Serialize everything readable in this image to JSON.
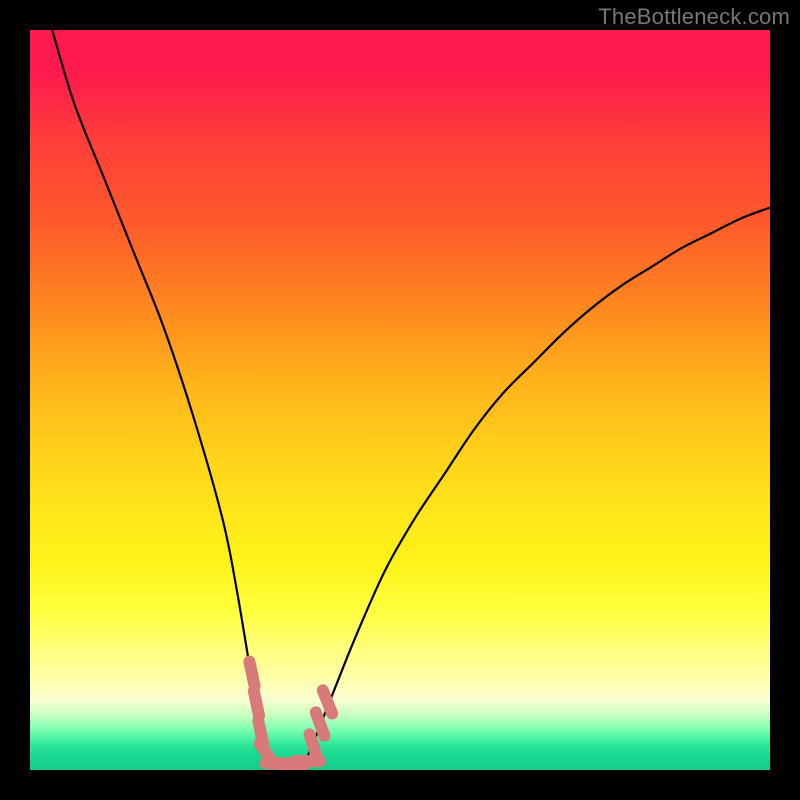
{
  "watermark": "TheBottleneck.com",
  "colors": {
    "page_bg": "#000000",
    "curve_stroke": "#000000",
    "marker": "#d97a7a",
    "marker_outline": "#d97a7a",
    "watermark_text": "#777777"
  },
  "chart_data": {
    "type": "line",
    "title": "",
    "xlabel": "",
    "ylabel": "",
    "xlim": [
      0,
      100
    ],
    "ylim": [
      0,
      100
    ],
    "grid": false,
    "legend": false,
    "description": "V-shaped bottleneck curve: steep left descent to ~0 near x≈31–38, then a concave rise to the right edge. Background is a red→yellow→green gradient indicating bad→good regions. Salmon pill markers cluster along the curve near the bottom of the V.",
    "series": [
      {
        "name": "bottleneck-curve",
        "x": [
          3,
          6,
          10,
          14,
          18,
          22,
          26,
          28,
          30,
          31,
          33,
          35,
          37,
          38,
          40,
          44,
          48,
          52,
          56,
          60,
          64,
          68,
          72,
          76,
          80,
          84,
          88,
          92,
          96,
          100
        ],
        "y": [
          100,
          90,
          80,
          70,
          60,
          48,
          34,
          24,
          12,
          6,
          1.5,
          0.8,
          1.2,
          3,
          8,
          18,
          27,
          34,
          40,
          46,
          51,
          55,
          59,
          62.5,
          65.5,
          68,
          70.5,
          72.5,
          74.5,
          76
        ]
      }
    ],
    "markers": [
      {
        "x": 30.0,
        "y": 13.0,
        "len": 5,
        "angle": 78
      },
      {
        "x": 30.6,
        "y": 9.0,
        "len": 5,
        "angle": 78
      },
      {
        "x": 31.2,
        "y": 5.0,
        "len": 5,
        "angle": 78
      },
      {
        "x": 32.0,
        "y": 2.2,
        "len": 5,
        "angle": 55
      },
      {
        "x": 33.5,
        "y": 0.9,
        "len": 5,
        "angle": 0
      },
      {
        "x": 35.5,
        "y": 0.8,
        "len": 5,
        "angle": 0
      },
      {
        "x": 37.5,
        "y": 1.2,
        "len": 5,
        "angle": 0
      },
      {
        "x": 38.3,
        "y": 3.2,
        "len": 5,
        "angle": 72
      },
      {
        "x": 39.2,
        "y": 6.2,
        "len": 5,
        "angle": 70
      },
      {
        "x": 40.2,
        "y": 9.2,
        "len": 5,
        "angle": 68
      }
    ]
  }
}
